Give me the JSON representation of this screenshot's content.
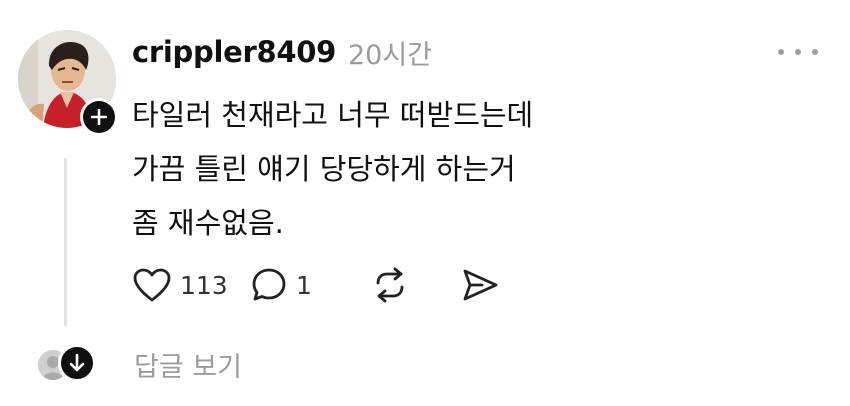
{
  "post": {
    "username": "crippler8409",
    "time_ago": "20시간",
    "content_lines": [
      "타일러 천재라고 너무 떠받드는데",
      "가끔 틀린 얘기 당당하게 하는거",
      "좀 재수없음."
    ],
    "icons": {
      "avatar": "profile-photo",
      "follow": "plus-icon",
      "more": "ellipsis-icon",
      "like": "heart-icon",
      "reply": "speech-bubble-icon",
      "repost": "repost-icon",
      "share": "send-icon",
      "view_replies": "arrow-down-icon"
    },
    "like_count": "113",
    "reply_count": "1",
    "view_replies_label": "답글 보기"
  }
}
